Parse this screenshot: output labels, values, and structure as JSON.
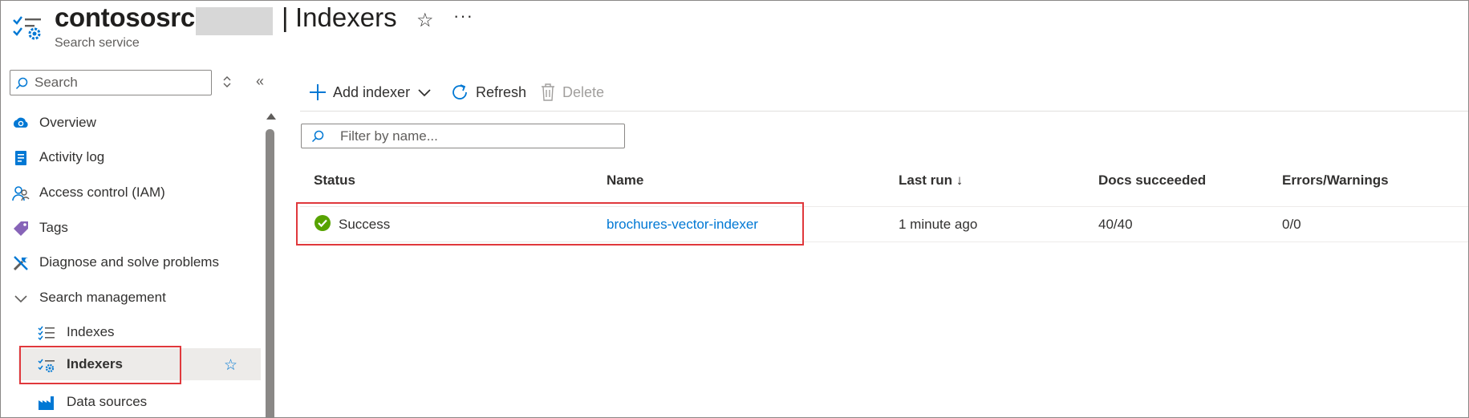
{
  "header": {
    "service_name": "contososrch",
    "separator": "|",
    "page_title": "Indexers",
    "subtitle": "Search service",
    "favorite_icon": "star-outline-icon",
    "more_icon": "ellipsis-icon"
  },
  "sidebar": {
    "search_placeholder": "Search",
    "items": [
      {
        "label": "Overview",
        "icon": "cloud-search-icon"
      },
      {
        "label": "Activity log",
        "icon": "activity-log-icon"
      },
      {
        "label": "Access control (IAM)",
        "icon": "people-icon"
      },
      {
        "label": "Tags",
        "icon": "tag-icon"
      },
      {
        "label": "Diagnose and solve problems",
        "icon": "wrench-icon"
      },
      {
        "label": "Search management",
        "icon": "chevron-down-icon"
      },
      {
        "label": "Indexes",
        "icon": "list-check-icon"
      },
      {
        "label": "Indexers",
        "icon": "indexer-gear-icon"
      },
      {
        "label": "Data sources",
        "icon": "factory-icon"
      }
    ]
  },
  "toolbar": {
    "add_label": "Add indexer",
    "refresh_label": "Refresh",
    "delete_label": "Delete"
  },
  "filter": {
    "placeholder": "Filter by name..."
  },
  "table": {
    "columns": [
      "Status",
      "Name",
      "Last run ↓",
      "Docs succeeded",
      "Errors/Warnings"
    ],
    "rows": [
      {
        "status": "Success",
        "name": "brochures-vector-indexer",
        "last_run": "1 minute ago",
        "docs_succeeded": "40/40",
        "errors_warnings": "0/0"
      }
    ]
  },
  "colors": {
    "accent": "#0078d4",
    "highlight_box": "#e0383c",
    "success": "#57a300"
  }
}
